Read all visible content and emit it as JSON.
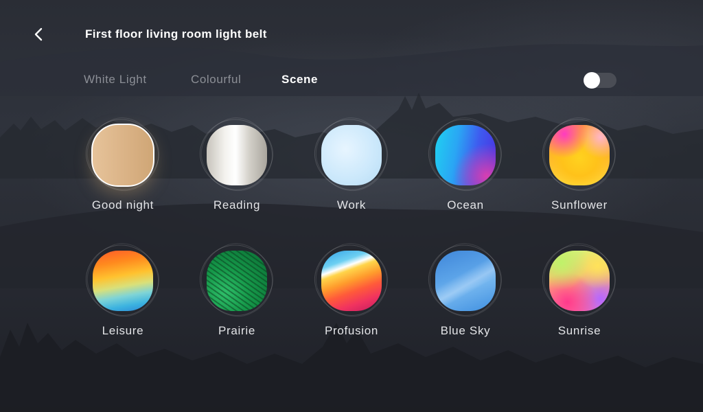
{
  "header": {
    "back_icon": "chevron-left-icon",
    "title": "First floor living room light belt"
  },
  "tabs": [
    {
      "label": "White Light",
      "active": false
    },
    {
      "label": "Colourful",
      "active": false
    },
    {
      "label": "Scene",
      "active": true
    }
  ],
  "power_toggle": {
    "state": "off"
  },
  "scenes": [
    {
      "label": "Good night",
      "selected": true,
      "colors": [
        "#e6c39a",
        "#cfa676"
      ]
    },
    {
      "label": "Reading",
      "selected": false,
      "colors": [
        "#c7c3bb",
        "#ffffff",
        "#a9a59d"
      ]
    },
    {
      "label": "Work",
      "selected": false,
      "colors": [
        "#e7f5ff",
        "#b7dcf4"
      ]
    },
    {
      "label": "Ocean",
      "selected": false,
      "colors": [
        "#1fd2f0",
        "#4b2ee0",
        "#d83fb1"
      ]
    },
    {
      "label": "Sunflower",
      "selected": false,
      "colors": [
        "#ff3bc0",
        "#ffd21f",
        "#ff9c3a"
      ]
    },
    {
      "label": "Leisure",
      "selected": false,
      "colors": [
        "#ff5a2a",
        "#ffc22f",
        "#3cb3e0"
      ]
    },
    {
      "label": "Prairie",
      "selected": false,
      "colors": [
        "#2fbf6a",
        "#0a6e34"
      ]
    },
    {
      "label": "Profusion",
      "selected": false,
      "colors": [
        "#2f9fe6",
        "#ffd44a",
        "#f1335f"
      ]
    },
    {
      "label": "Blue Sky",
      "selected": false,
      "colors": [
        "#3f86d9",
        "#74b6ef"
      ]
    },
    {
      "label": "Sunrise",
      "selected": false,
      "colors": [
        "#bff26a",
        "#ff3a8c",
        "#b567ff"
      ]
    }
  ],
  "theme": {
    "background": "#22252d",
    "text_primary": "#ffffff",
    "text_inactive": "#8c8f96",
    "toggle_track": "#4a4d55"
  }
}
